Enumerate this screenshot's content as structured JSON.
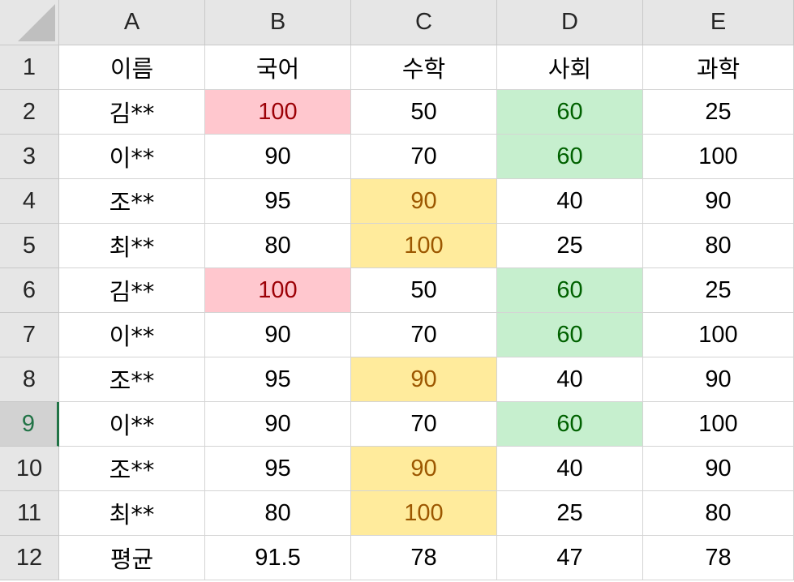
{
  "colors": {
    "header_bg": "#e6e6e6",
    "grid_line": "#d4d4d4",
    "active_row_accent": "#217346",
    "red_fill": "#ffc7ce",
    "red_text": "#9c0006",
    "yellow_fill": "#ffeb9c",
    "yellow_text": "#9c5700",
    "green_fill": "#c6efce",
    "green_text": "#006100"
  },
  "icons": {
    "corner": "select-all-triangle-icon"
  },
  "column_headers": [
    "A",
    "B",
    "C",
    "D",
    "E"
  ],
  "row_headers": [
    "1",
    "2",
    "3",
    "4",
    "5",
    "6",
    "7",
    "8",
    "9",
    "10",
    "11",
    "12"
  ],
  "active_row": "9",
  "rows": [
    [
      "이름",
      "국어",
      "수학",
      "사회",
      "과학"
    ],
    [
      "김**",
      "100",
      "50",
      "60",
      "25"
    ],
    [
      "이**",
      "90",
      "70",
      "60",
      "100"
    ],
    [
      "조**",
      "95",
      "90",
      "40",
      "90"
    ],
    [
      "최**",
      "80",
      "100",
      "25",
      "80"
    ],
    [
      "김**",
      "100",
      "50",
      "60",
      "25"
    ],
    [
      "이**",
      "90",
      "70",
      "60",
      "100"
    ],
    [
      "조**",
      "95",
      "90",
      "40",
      "90"
    ],
    [
      "이**",
      "90",
      "70",
      "60",
      "100"
    ],
    [
      "조**",
      "95",
      "90",
      "40",
      "90"
    ],
    [
      "최**",
      "80",
      "100",
      "25",
      "80"
    ],
    [
      "평균",
      "91.5",
      "78",
      "47",
      "78"
    ]
  ],
  "highlights": [
    [
      "",
      "",
      "",
      "",
      ""
    ],
    [
      "",
      "red",
      "",
      "green",
      ""
    ],
    [
      "",
      "",
      "",
      "green",
      ""
    ],
    [
      "",
      "",
      "yellow",
      "",
      ""
    ],
    [
      "",
      "",
      "yellow",
      "",
      ""
    ],
    [
      "",
      "red",
      "",
      "green",
      ""
    ],
    [
      "",
      "",
      "",
      "green",
      ""
    ],
    [
      "",
      "",
      "yellow",
      "",
      ""
    ],
    [
      "",
      "",
      "",
      "green",
      ""
    ],
    [
      "",
      "",
      "yellow",
      "",
      ""
    ],
    [
      "",
      "",
      "yellow",
      "",
      ""
    ],
    [
      "",
      "",
      "",
      "",
      ""
    ]
  ]
}
